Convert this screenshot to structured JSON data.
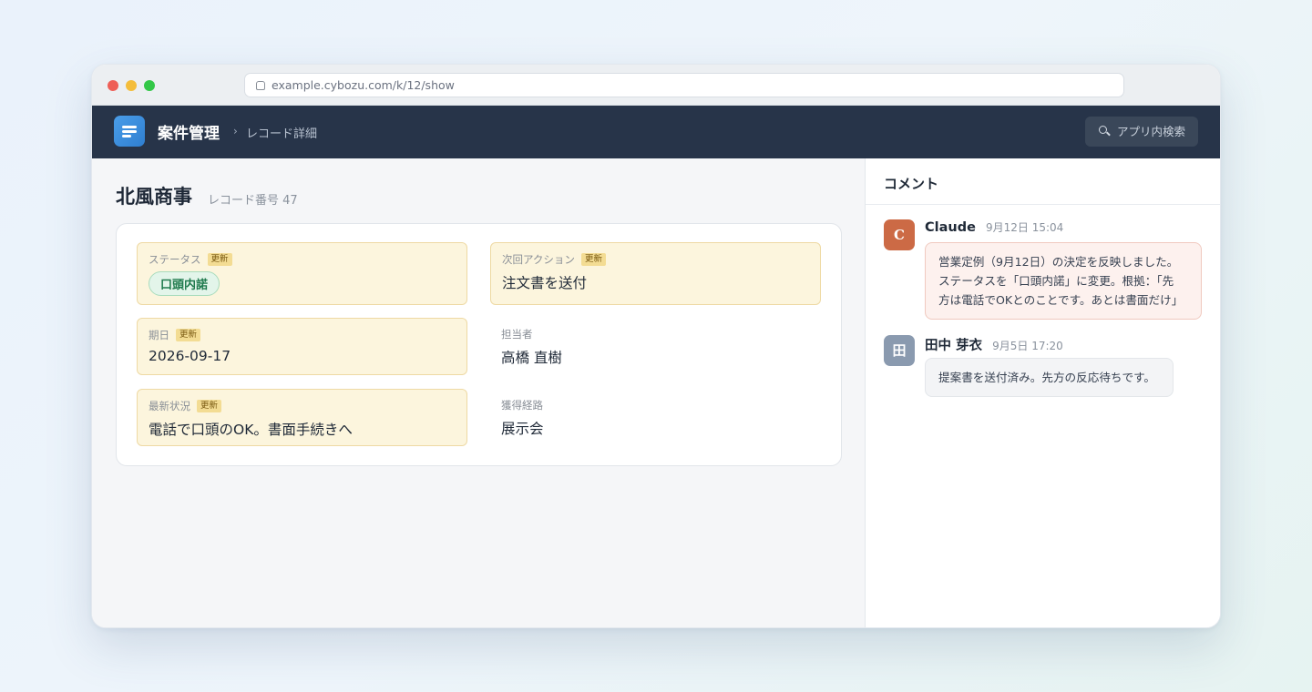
{
  "browser": {
    "url": "example.cybozu.com/k/12/show"
  },
  "appbar": {
    "title": "案件管理",
    "breadcrumb_sep": "›",
    "breadcrumb": "レコード詳細",
    "search_label": "アプリ内検索"
  },
  "record": {
    "title": "北風商事",
    "number_label": "レコード番号 47",
    "updated_badge": "更新",
    "fields": {
      "status": {
        "label": "ステータス",
        "value": "口頭内諾",
        "updated": true
      },
      "next_action": {
        "label": "次回アクション",
        "value": "注文書を送付",
        "updated": true
      },
      "due_date": {
        "label": "期日",
        "value": "2026-09-17",
        "updated": true
      },
      "owner": {
        "label": "担当者",
        "value": "高橋 直樹",
        "updated": false
      },
      "latest": {
        "label": "最新状況",
        "value": "電話で口頭のOK。書面手続きへ",
        "updated": true
      },
      "source": {
        "label": "獲得経路",
        "value": "展示会",
        "updated": false
      }
    }
  },
  "comments": {
    "header": "コメント",
    "items": [
      {
        "avatar": "C",
        "author": "Claude",
        "time": "9月12日 15:04",
        "lines": [
          "営業定例（9月12日）の決定を反映しました。",
          "ステータスを「口頭内諾」に変更。根拠：「先",
          "方は電話でOKとのことです。あとは書面だけ」"
        ]
      },
      {
        "avatar": "田",
        "author": "田中 芽衣",
        "time": "9月5日 17:20",
        "lines": [
          "提案書を送付済み。先方の反応待ちです。"
        ]
      }
    ]
  },
  "colors": {
    "appbar_bg": "#273449",
    "highlight_bg": "#fcf5dd",
    "status_green": "#1f7a4d",
    "claude_avatar": "#cc6a45"
  }
}
